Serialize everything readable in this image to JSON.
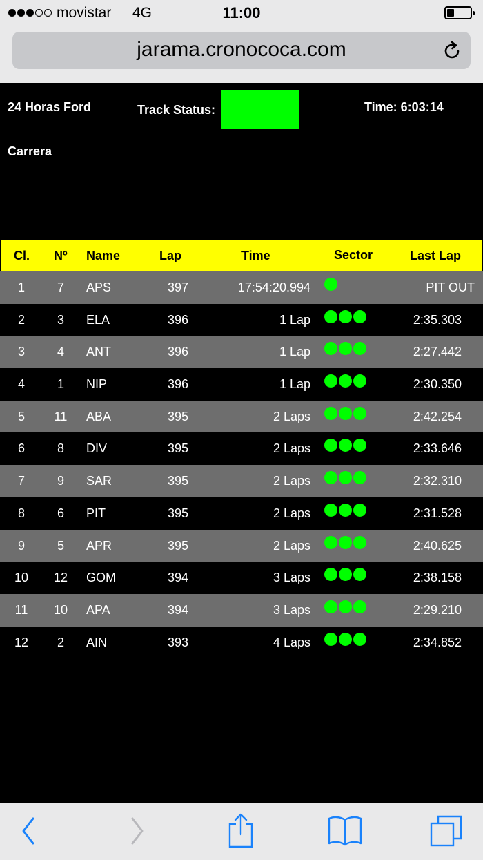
{
  "status_bar": {
    "carrier": "movistar",
    "network": "4G",
    "time": "11:00"
  },
  "browser": {
    "url": "jarama.cronococa.com"
  },
  "header": {
    "event_name": "24 Horas Ford",
    "track_status_label": "Track Status:",
    "track_status_color": "#00ff00",
    "time_label": "Time: 6:03:14",
    "session": "Carrera"
  },
  "table": {
    "columns": {
      "cl": "Cl.",
      "no": "Nº",
      "name": "Name",
      "lap": "Lap",
      "time": "Time",
      "sector": "Sector",
      "last_lap": "Last Lap"
    },
    "rows": [
      {
        "cl": "1",
        "no": "7",
        "name": "APS",
        "lap": "397",
        "time": "17:54:20.994",
        "sectors": 1,
        "last_lap": "PIT OUT"
      },
      {
        "cl": "2",
        "no": "3",
        "name": "ELA",
        "lap": "396",
        "time": "1 Lap",
        "sectors": 3,
        "last_lap": "2:35.303"
      },
      {
        "cl": "3",
        "no": "4",
        "name": "ANT",
        "lap": "396",
        "time": "1 Lap",
        "sectors": 3,
        "last_lap": "2:27.442"
      },
      {
        "cl": "4",
        "no": "1",
        "name": "NIP",
        "lap": "396",
        "time": "1 Lap",
        "sectors": 3,
        "last_lap": "2:30.350"
      },
      {
        "cl": "5",
        "no": "11",
        "name": "ABA",
        "lap": "395",
        "time": "2 Laps",
        "sectors": 3,
        "last_lap": "2:42.254"
      },
      {
        "cl": "6",
        "no": "8",
        "name": "DIV",
        "lap": "395",
        "time": "2 Laps",
        "sectors": 3,
        "last_lap": "2:33.646"
      },
      {
        "cl": "7",
        "no": "9",
        "name": "SAR",
        "lap": "395",
        "time": "2 Laps",
        "sectors": 3,
        "last_lap": "2:32.310"
      },
      {
        "cl": "8",
        "no": "6",
        "name": "PIT",
        "lap": "395",
        "time": "2 Laps",
        "sectors": 3,
        "last_lap": "2:31.528"
      },
      {
        "cl": "9",
        "no": "5",
        "name": "APR",
        "lap": "395",
        "time": "2 Laps",
        "sectors": 3,
        "last_lap": "2:40.625"
      },
      {
        "cl": "10",
        "no": "12",
        "name": "GOM",
        "lap": "394",
        "time": "3 Laps",
        "sectors": 3,
        "last_lap": "2:38.158"
      },
      {
        "cl": "11",
        "no": "10",
        "name": "APA",
        "lap": "394",
        "time": "3 Laps",
        "sectors": 3,
        "last_lap": "2:29.210"
      },
      {
        "cl": "12",
        "no": "2",
        "name": "AIN",
        "lap": "393",
        "time": "4 Laps",
        "sectors": 3,
        "last_lap": "2:34.852"
      }
    ]
  },
  "colors": {
    "header_bg": "#ffff00",
    "row_alt": "#6e6e6e",
    "sector_dot": "#00ff00",
    "ios_blue": "#1a82fb"
  },
  "toolbar": {
    "icons": [
      "back-icon",
      "forward-icon",
      "share-icon",
      "bookmarks-icon",
      "tabs-icon"
    ]
  }
}
